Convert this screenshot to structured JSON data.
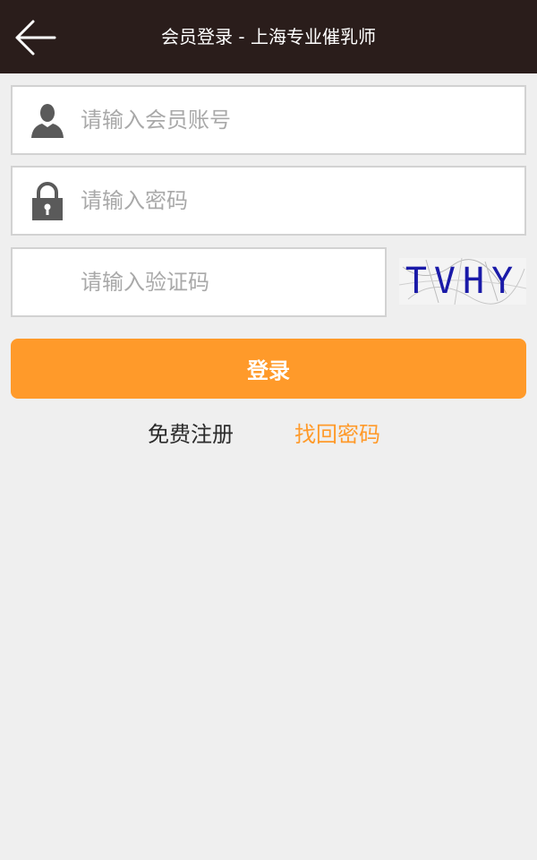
{
  "header": {
    "title": "会员登录 - 上海专业催乳师",
    "back_icon": "arrow-left-icon"
  },
  "form": {
    "account_placeholder": "请输入会员账号",
    "account_icon": "user-icon",
    "password_placeholder": "请输入密码",
    "password_icon": "lock-icon",
    "captcha_placeholder": "请输入验证码",
    "captcha_code": "TVHY",
    "login_label": "登录"
  },
  "links": {
    "register": "免费注册",
    "recover": "找回密码"
  },
  "colors": {
    "header_bg": "#2a1d1b",
    "accent": "#ff9a2a",
    "page_bg": "#efefef"
  }
}
